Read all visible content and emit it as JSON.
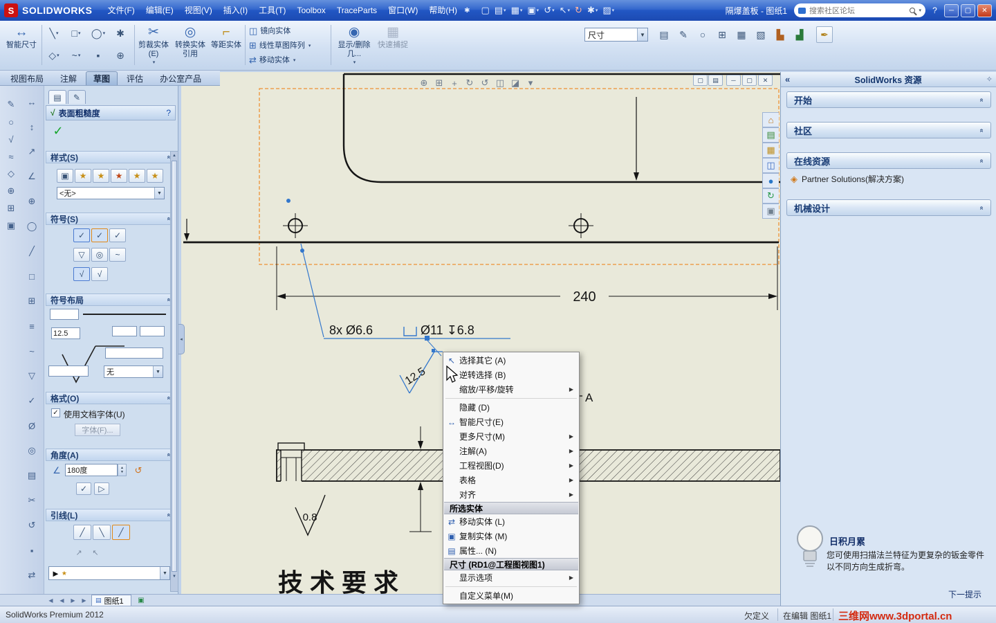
{
  "titlebar": {
    "app_name": "SOLIDWORKS",
    "menus": [
      "文件(F)",
      "编辑(E)",
      "视图(V)",
      "插入(I)",
      "工具(T)",
      "Toolbox",
      "TraceParts",
      "窗口(W)",
      "帮助(H)"
    ],
    "doc_title": "隔爆盖板 - 图纸1",
    "search_placeholder": "搜索社区论坛",
    "help": "?"
  },
  "toolbar": {
    "smart_dimension": "智能尺寸",
    "trim": "剪裁实体(E)",
    "convert": "转换实体引用",
    "offset": "等距实体",
    "mirror": "镜向实体",
    "linear_pattern": "线性草图阵列",
    "move": "移动实体",
    "display_delete": "显示/删除几...",
    "quick_snap": "快速捕捉",
    "dim_combo_value": "尺寸"
  },
  "ribbon_tabs": [
    {
      "label": "视图布局"
    },
    {
      "label": "注解"
    },
    {
      "label": "草图"
    },
    {
      "label": "评估"
    },
    {
      "label": "办公室产品"
    }
  ],
  "property_panel": {
    "title": "表面粗糙度",
    "help": "?",
    "style_header": "样式(S)",
    "style_value": "<无>",
    "symbol_header": "符号(S)",
    "layout_header": "符号布局",
    "layout_value": "12.5",
    "layout_style": "无",
    "format_header": "格式(O)",
    "format_checkbox_label": "使用文档字体(U)",
    "font_button": "字体(F)...",
    "angle_header": "角度(A)",
    "angle_value": "180度",
    "leader_header": "引线(L)"
  },
  "drawing": {
    "dim_240": "240",
    "hole_callout_qty": "8x Ø6.6",
    "hole_callout_cbore": "Ø11 ↧6.8",
    "roughness_12_5": "12.5",
    "roughness_0_8": "0.8",
    "tech_note": "技术要求",
    "section_label": "A"
  },
  "context_menu": {
    "items": [
      {
        "label": "选择其它 (A)"
      },
      {
        "label": "逆转选择 (B)"
      },
      {
        "label": "缩放/平移/旋转"
      },
      {
        "label": "隐藏 (D)"
      },
      {
        "label": "智能尺寸(E)"
      },
      {
        "label": "更多尺寸(M)"
      },
      {
        "label": "注解(A)"
      },
      {
        "label": "工程视图(D)"
      },
      {
        "label": "表格"
      },
      {
        "label": "对齐"
      },
      {
        "label": "所选实体"
      },
      {
        "label": "移动实体 (L)"
      },
      {
        "label": "复制实体 (M)"
      },
      {
        "label": "属性... (N)"
      },
      {
        "label": "尺寸 (RD1@工程图视图1)"
      },
      {
        "label": "显示选项"
      },
      {
        "label": "自定义菜单(M)"
      }
    ]
  },
  "task_pane": {
    "title": "SolidWorks 资源",
    "sections": [
      {
        "label": "开始"
      },
      {
        "label": "社区"
      },
      {
        "label": "在线资源"
      },
      {
        "label": "机械设计"
      }
    ],
    "partner_link": "Partner Solutions(解决方案)",
    "tip_title": "日积月累",
    "tip_text": "您可使用扫描法兰特征为更复杂的钣金零件以不同方向生成折弯。",
    "tip_next": "下一提示"
  },
  "sheet_bar": {
    "active_tab": "图纸1"
  },
  "status_bar": {
    "product": "SolidWorks Premium 2012",
    "definition_state": "欠定义",
    "editing": "在编辑 图纸1",
    "watermark": "三维网www.3dportal.cn"
  },
  "colors": {
    "annotation_blue": "#3377cc",
    "selection_orange": "#ef9234",
    "canvas_beige": "#e9e9da"
  },
  "icons": {
    "logo": "S",
    "pin": "✱",
    "new_doc": "▢",
    "open": "▤",
    "save": "▦",
    "print": "▣",
    "undo": "↺",
    "redo": "↻",
    "select": "↖",
    "rebuild": "↻",
    "options": "✱",
    "appearance": "▨",
    "caret": "▾",
    "caret_down": "▼",
    "minimize": "─",
    "maximize": "▢",
    "close": "✕",
    "help": "?",
    "smart_dim": "↔",
    "line": "╲",
    "rectangle": "□",
    "circle": "◯",
    "asterisk": "✱",
    "polygon": "◇",
    "spline": "~",
    "point": "▪",
    "trim": "✂",
    "convert": "◎",
    "offset": "⌐",
    "mirror": "◫",
    "pattern": "⊞",
    "move": "⇄",
    "display_relations": "◉",
    "quick_snap": "▦",
    "style": "▤",
    "note": "✎",
    "balloon": "○",
    "table": "⊞",
    "hole_table": "▦",
    "revision_table": "▧",
    "chart_a": "▙",
    "chart_b": "▟",
    "format_painter": "✒",
    "check": "✓",
    "star": "★",
    "angle": "∠",
    "spin_up": "▲",
    "spin_down": "▼",
    "leader_a": "╱",
    "leader_b": "╲",
    "arrow_style": "►",
    "flip": "▷",
    "submenu": "▶",
    "select_other": "↖",
    "copy": "▣",
    "properties": "▤",
    "chevron": "«",
    "partner": "◈",
    "pane_pin": "✧",
    "prev": "◀",
    "next": "▶",
    "sheet": "▤",
    "add_sheet": "▣",
    "home": "⌂",
    "resources": "▤",
    "folder": "▦",
    "library": "◫",
    "globe": "●",
    "refresh": "↻",
    "docicon": "▣",
    "zoom": "⊕",
    "zoom_fit": "⊞",
    "pan": "+",
    "rotate": "↻",
    "prev_view": "↺",
    "section": "◫",
    "display_style": "◪",
    "view_settings": "▾",
    "surface_finish": "√",
    "weld": "≈",
    "gtol": "⊕",
    "datum": "◇",
    "center_mark": "⊕",
    "dim_h": "↔",
    "dim_v": "↕",
    "dim_o": "↗",
    "perp": "⊥",
    "tri_down": "▽",
    "oslash": "Ø",
    "menu_lines": "≡",
    "grid": "▦",
    "dot": "▪"
  }
}
